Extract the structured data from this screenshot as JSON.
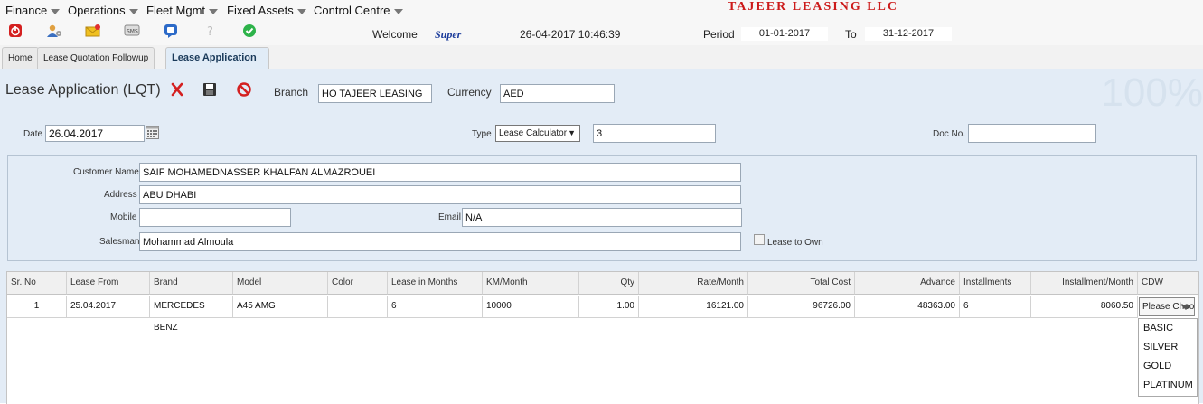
{
  "menu": {
    "items": [
      "Finance",
      "Operations",
      "Fleet Mgmt",
      "Fixed Assets",
      "Control Centre"
    ],
    "company": "TAJEER LEASING LLC"
  },
  "toolbar": {
    "icons": [
      "power-icon",
      "user-settings-icon",
      "mail-icon",
      "sms-icon",
      "chat-icon",
      "help-icon",
      "check-icon"
    ],
    "welcome_label": "Welcome",
    "username": "Super",
    "datetime": "26-04-2017 10:46:39",
    "period_label": "Period",
    "period_from": "01-01-2017",
    "to_label": "To",
    "period_to": "31-12-2017"
  },
  "tabs": [
    "Home",
    "Lease Quotation Followup",
    "Lease Application"
  ],
  "form": {
    "title": "Lease Application (LQT)",
    "watermark": "100%",
    "branch_label": "Branch",
    "branch_value": "HO TAJEER LEASING",
    "currency_label": "Currency",
    "currency_value": "AED",
    "date_label": "Date",
    "date_value": "26.04.2017",
    "type_label": "Type",
    "type_value": "Lease Calculator",
    "type_number": "3",
    "docno_label": "Doc No.",
    "docno_value": "",
    "customer_label": "Customer Name",
    "customer_value": "SAIF MOHAMEDNASSER KHALFAN ALMAZROUEI",
    "address_label": "Address",
    "address_value": "ABU DHABI",
    "mobile_label": "Mobile",
    "mobile_value": "",
    "email_label": "Email",
    "email_value": "N/A",
    "salesman_label": "Salesman",
    "salesman_value": "Mohammad Almoula",
    "lease_to_own_label": "Lease to Own"
  },
  "table": {
    "headers": [
      "Sr. No",
      "Lease From",
      "Brand",
      "Model",
      "Color",
      "Lease in Months",
      "KM/Month",
      "Qty",
      "Rate/Month",
      "Total Cost",
      "Advance",
      "Installments",
      "Installment/Month",
      "CDW"
    ],
    "row": [
      "1",
      "25.04.2017",
      "MERCEDES BENZ",
      "A45 AMG",
      "",
      "6",
      "10000",
      "1.00",
      "16121.00",
      "96726.00",
      "48363.00",
      "6",
      "8060.50"
    ],
    "cdw_selected": "Please Choose",
    "cdw_options": [
      "BASIC",
      "SILVER",
      "GOLD",
      "PLATINUM"
    ]
  },
  "colors": {
    "accent_red": "#cc1a1a",
    "content_bg": "#e3ecf6",
    "username_blue": "#1a3a9a"
  }
}
